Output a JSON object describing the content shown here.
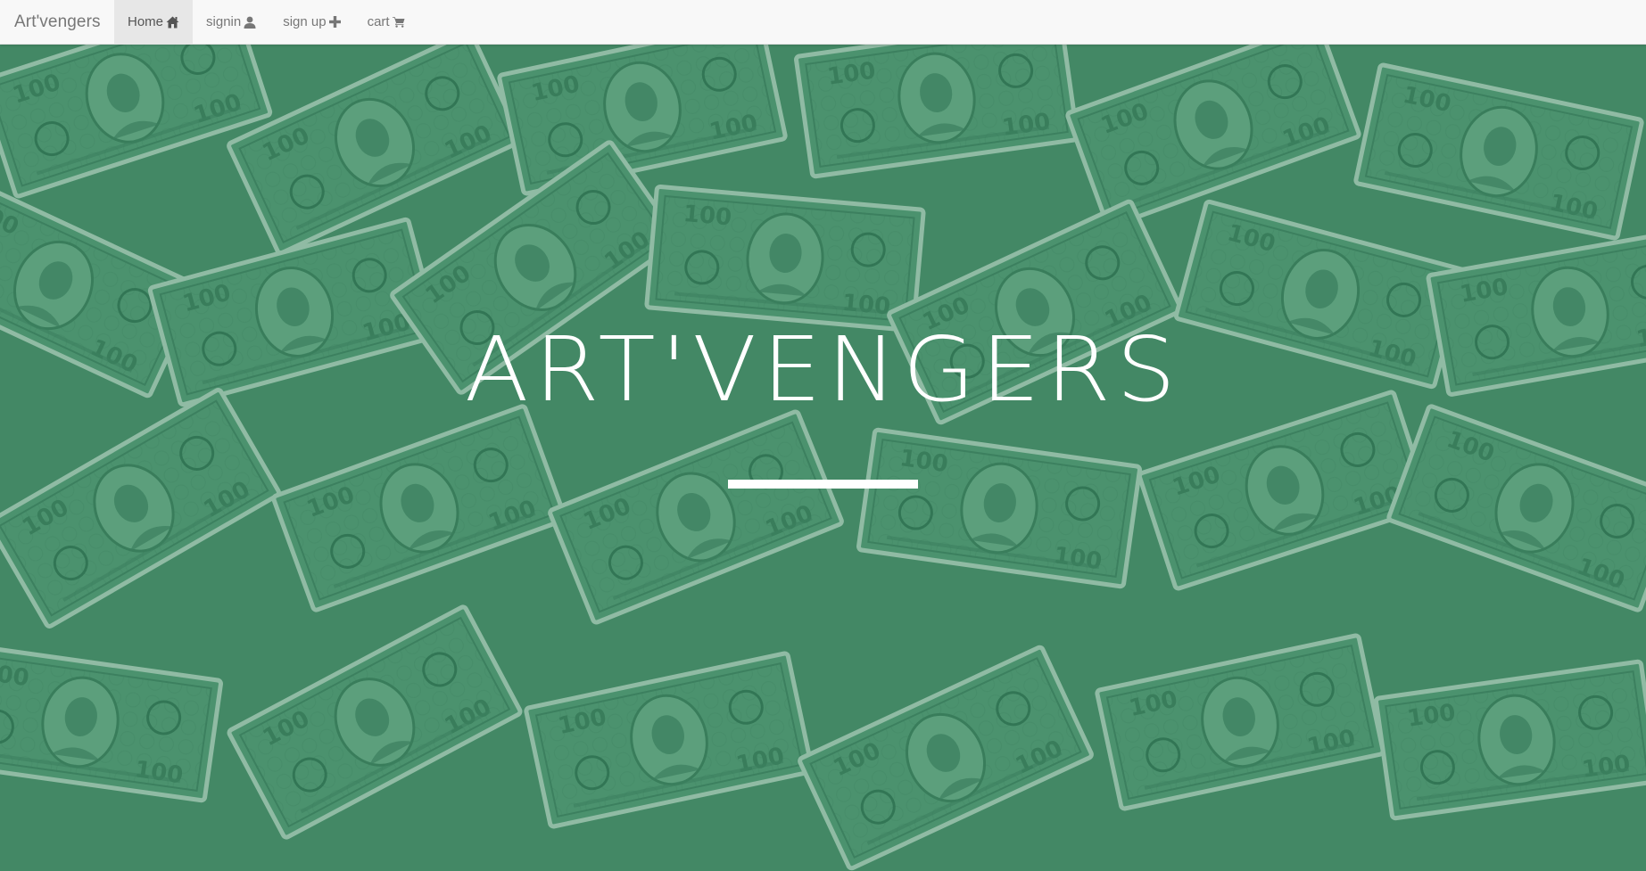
{
  "navbar": {
    "brand": "Art'vengers",
    "items": [
      {
        "label": "Home",
        "icon": "home-icon",
        "active": true
      },
      {
        "label": "signin",
        "icon": "user-icon",
        "active": false
      },
      {
        "label": "sign up",
        "icon": "plus-icon",
        "active": false
      },
      {
        "label": "cart",
        "icon": "cart-icon",
        "active": false
      }
    ]
  },
  "hero": {
    "title": "ART'VENGERS",
    "background": "hundred-dollar-bills-image",
    "overlay_color": "#4e9170"
  }
}
